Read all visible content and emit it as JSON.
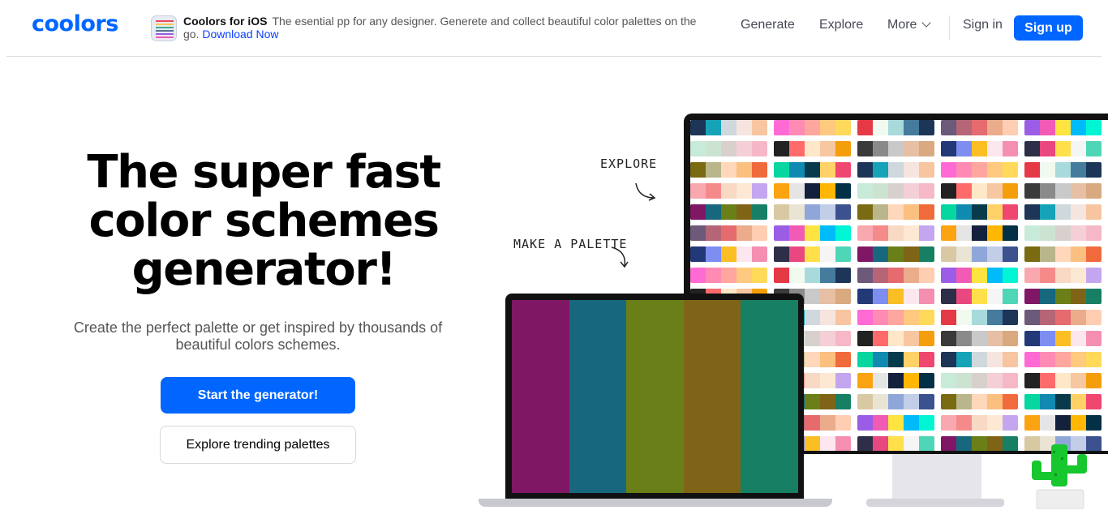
{
  "header": {
    "logo": "coolors",
    "promo": {
      "title": "Coolors for iOS",
      "text": "The esential pp for any designer. Generete and collect beautiful color palettes on the go.",
      "link": "Download Now"
    },
    "nav": {
      "generate": "Generate",
      "explore": "Explore",
      "more": "More",
      "sign_in": "Sign in",
      "sign_up": "Sign up"
    }
  },
  "hero": {
    "title_line1": "The super fast",
    "title_line2": "color schemes",
    "title_line3": "generator!",
    "subtitle": "Create the perfect palette or get inspired by thousands of beautiful colors schemes.",
    "primary_button": "Start the generator!",
    "secondary_button": "Explore trending palettes"
  },
  "illustration": {
    "label_explore": "EXPLORE",
    "label_make": "MAKE A PALETTE",
    "laptop_palette": [
      "#7f1765",
      "#17687f",
      "#6a7f17",
      "#7f6417",
      "#177f64"
    ]
  },
  "colors": {
    "accent": "#0066ff",
    "text_dark": "#000000",
    "text_muted": "#555555",
    "link": "#0a3fff",
    "cactus_green": "#16c72e"
  }
}
